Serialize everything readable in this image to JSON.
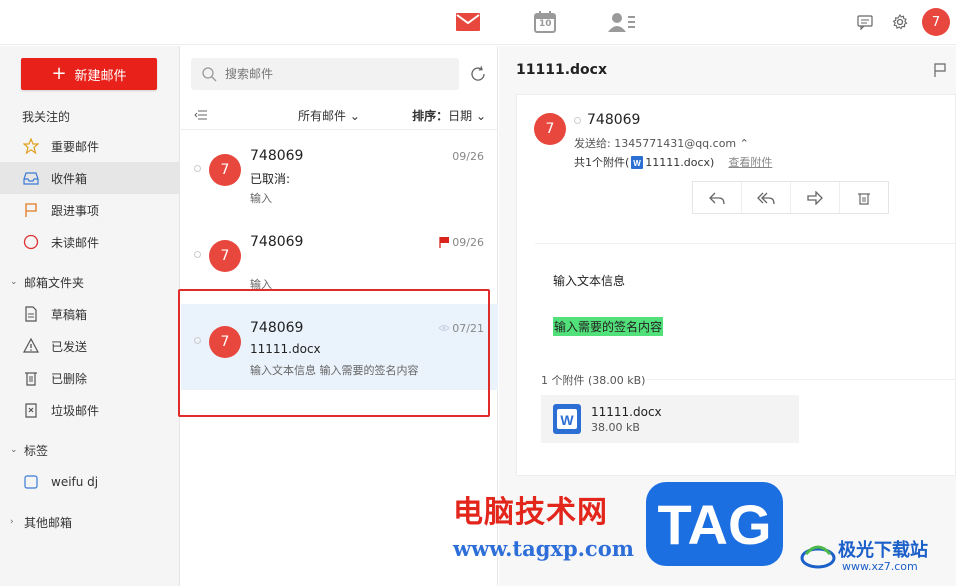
{
  "topbar": {
    "icons": [
      "mail-icon",
      "calendar-icon",
      "contacts-icon",
      "chat-icon",
      "gear-icon"
    ],
    "calendar_day": "10",
    "avatar_initial": "7",
    "accent": "#e8221b"
  },
  "sidebar": {
    "compose_label": "新建邮件",
    "sections": {
      "starred": "我关注的",
      "folders": "邮箱文件夹",
      "labels": "标签",
      "other": "其他邮箱"
    },
    "starred_items": [
      {
        "label": "重要邮件",
        "icon": "star-icon"
      },
      {
        "label": "收件箱",
        "icon": "inbox-icon"
      },
      {
        "label": "跟进事项",
        "icon": "flag-icon"
      },
      {
        "label": "未读邮件",
        "icon": "unread-circle-icon"
      }
    ],
    "folder_items": [
      {
        "label": "草稿箱",
        "icon": "draft-icon"
      },
      {
        "label": "已发送",
        "icon": "sent-icon"
      },
      {
        "label": "已删除",
        "icon": "trash-icon"
      },
      {
        "label": "垃圾邮件",
        "icon": "spam-icon"
      }
    ],
    "label_items": [
      {
        "label": "weifu dj",
        "icon": "checkbox-icon"
      }
    ]
  },
  "list": {
    "search_placeholder": "搜索邮件",
    "filter_label": "所有邮件",
    "sort_prefix": "排序：",
    "sort_value": "日期",
    "mails": [
      {
        "avatar": "7",
        "from": "748069",
        "subject": "已取消:",
        "preview": "输入",
        "date": "09/26"
      },
      {
        "avatar": "7",
        "from": "748069",
        "subject": "",
        "preview": "输入",
        "date": "09/26"
      },
      {
        "avatar": "7",
        "from": "748069",
        "subject": "11111.docx",
        "preview": "输入文本信息 输入需要的签名内容",
        "date": "07/21"
      }
    ]
  },
  "pane": {
    "title": "11111.docx",
    "avatar": "7",
    "sender": "748069",
    "to_line": "发送给: 1345771431@qq.com ⌃",
    "att_prefix": "共1个附件(",
    "att_name_inline": "11111.docx)",
    "view_attachments": "查看附件",
    "body_line1": "输入文本信息",
    "body_highlight": "输入需要的签名内容",
    "attachment_count": "1 个附件 (38.00 kB)",
    "attachment": {
      "name": "11111.docx",
      "size": "38.00 kB"
    },
    "highlight_color": "#52e07a"
  },
  "watermark": {
    "cn": "电脑技术网",
    "url": "www.tagxp.com",
    "tag": "TAG",
    "logo_cn": "极光下载站",
    "logo_url": "www.xz7.com"
  }
}
